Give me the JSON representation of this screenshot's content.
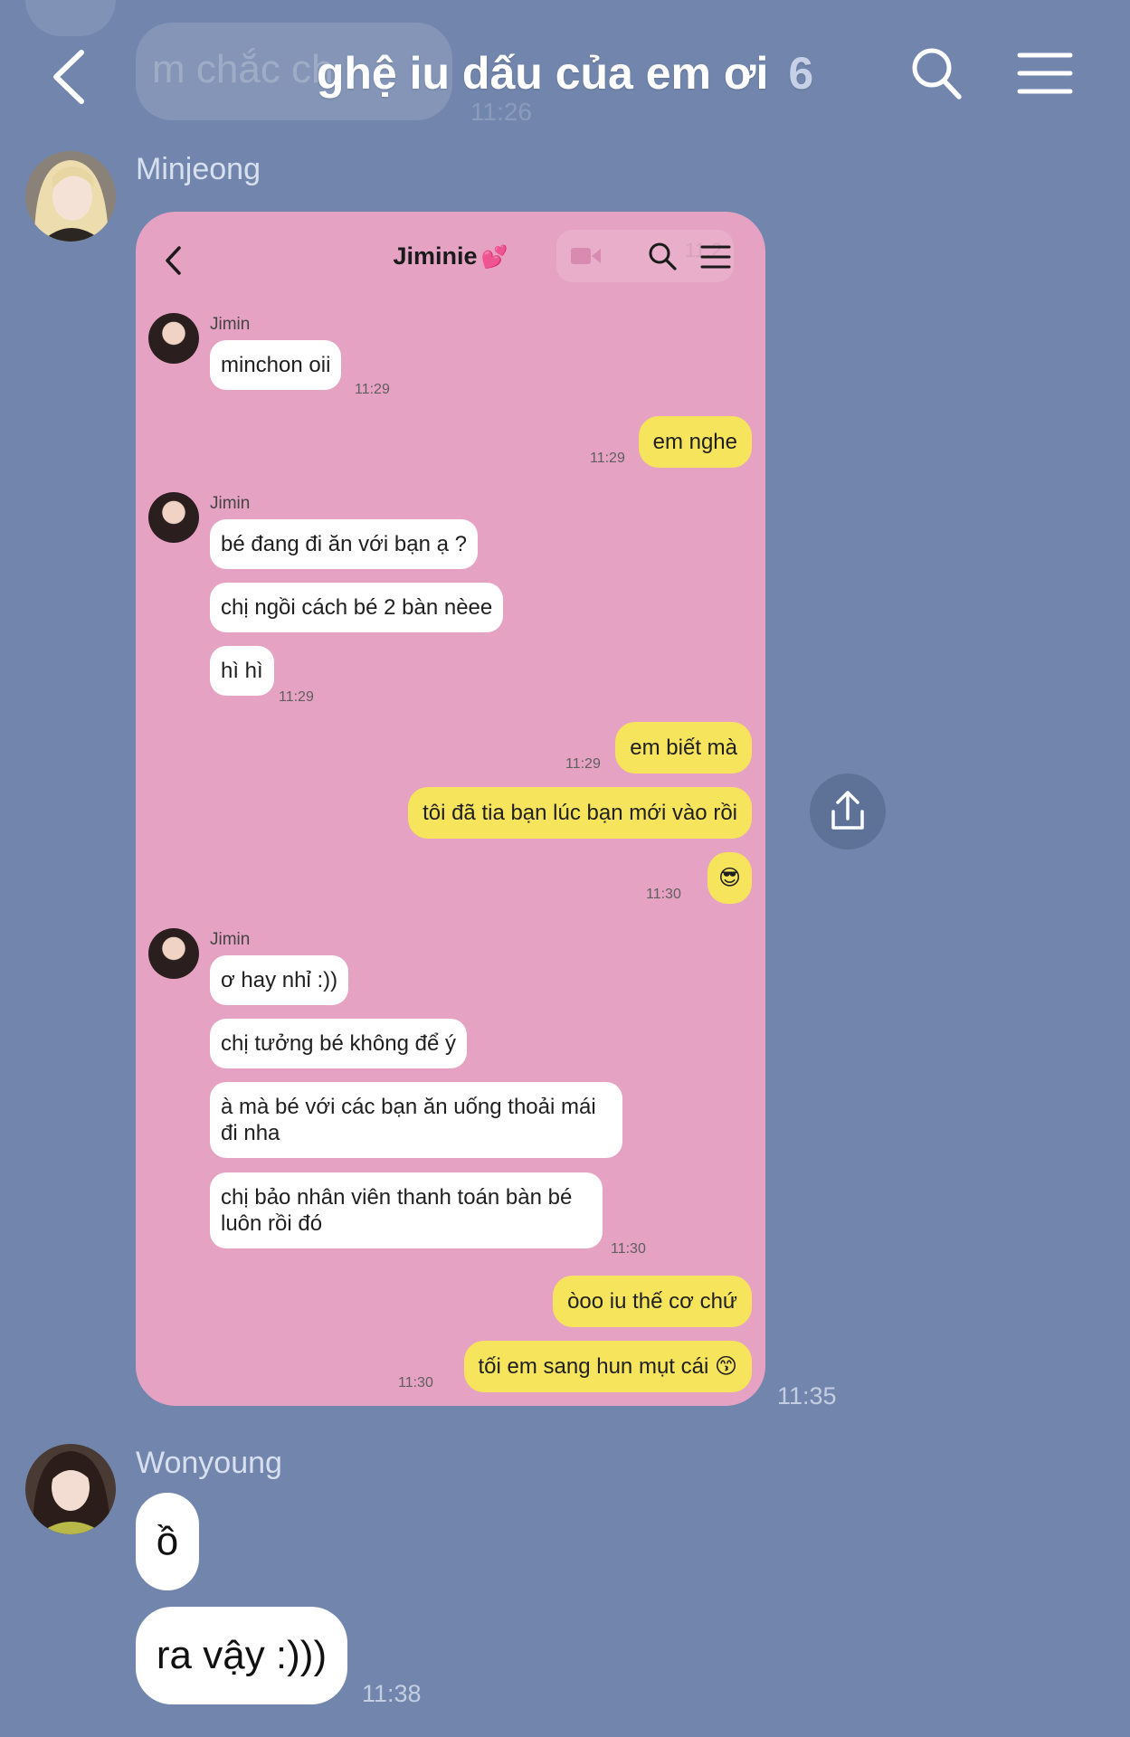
{
  "header": {
    "behind_text": "m chắc ch",
    "behind_time": "11:26",
    "title": "ghệ iu dấu của em ơi",
    "member_count": "6"
  },
  "messages": [
    {
      "sender": "Minjeong",
      "time": "11:35",
      "screenshot": {
        "title": "Jiminie",
        "title_emoji": "💕",
        "hidden_time": "11:2",
        "items": [
          {
            "sender": "Jimin",
            "text": "minchon oii",
            "time": "11:29"
          },
          {
            "text": "em nghe",
            "time": "11:29"
          },
          {
            "sender": "Jimin",
            "text": "bé đang đi ăn với bạn ạ ?"
          },
          {
            "text": "chị ngồi cách bé 2 bàn nèee"
          },
          {
            "text": "hì hì",
            "time": "11:29"
          },
          {
            "text": "em biết mà",
            "time": "11:29"
          },
          {
            "text": "tôi đã tia bạn lúc bạn mới vào rồi"
          },
          {
            "text": "😎",
            "time": "11:30"
          },
          {
            "sender": "Jimin",
            "text": "ơ hay nhỉ :))"
          },
          {
            "text": "chị tưởng bé không để ý"
          },
          {
            "text": "à mà bé với các bạn ăn uống thoải mái đi nha"
          },
          {
            "text": "chị bảo nhân viên thanh toán bàn bé luôn rồi đó",
            "time": "11:30"
          },
          {
            "text": "òoo iu thế cơ chứ"
          },
          {
            "text": "tối em sang hun mụt cái 😙",
            "time": "11:30"
          }
        ]
      }
    },
    {
      "sender": "Wonyoung",
      "lines": [
        "ồ",
        "ra vậy :)))"
      ],
      "time": "11:38"
    }
  ],
  "icons": {
    "back": "chevron-left-icon",
    "search": "search-icon",
    "menu": "hamburger-menu-icon",
    "share": "share-icon",
    "video": "video-icon"
  },
  "colors": {
    "background": "#7286ad",
    "screenshot_bg": "#e6a2c2",
    "my_bubble": "#f5e45c",
    "their_bubble": "#ffffff"
  }
}
